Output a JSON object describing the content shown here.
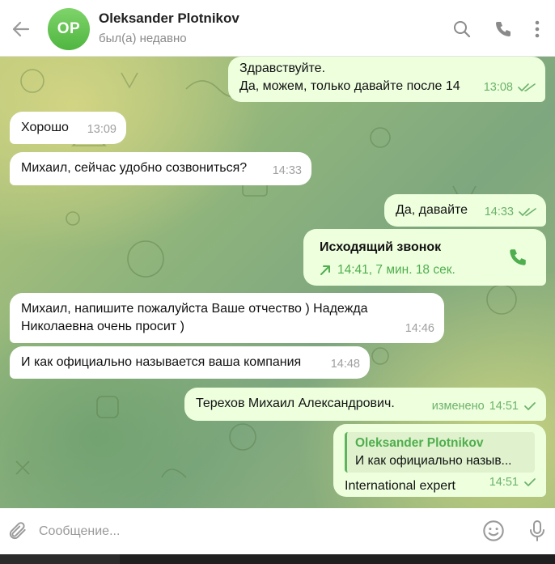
{
  "header": {
    "avatar_initials": "OP",
    "name": "Oleksander Plotnikov",
    "status": "был(а) недавно"
  },
  "messages": {
    "m1": {
      "line1": "Здравствуйте.",
      "line2": "Да, можем, только давайте после 14",
      "time": "13:08"
    },
    "m2": {
      "text": "Хорошо",
      "time": "13:09"
    },
    "m3": {
      "text": "Михаил, сейчас удобно созвониться?",
      "time": "14:33"
    },
    "m4": {
      "text": "Да, давайте",
      "time": "14:33"
    },
    "m5": {
      "title": "Исходящий звонок",
      "detail": "14:41, 7 мин. 18 сек."
    },
    "m6": {
      "line1": "Михаил, напишите пожалуйста Ваше отчество ) Надежда",
      "line2": "Николаевна очень просит )",
      "time": "14:46"
    },
    "m7": {
      "text": "И как официально называется ваша компания",
      "time": "14:48"
    },
    "m8": {
      "text": "Терехов Михаил Александрович.",
      "edited": "изменено",
      "time": "14:51"
    },
    "m9": {
      "reply_name": "Oleksander Plotnikov",
      "reply_text": "И как официально назыв...",
      "text": "International expert",
      "time": "14:51"
    }
  },
  "composer": {
    "placeholder": "Сообщение..."
  },
  "colors": {
    "accent": "#4fae4e",
    "outgoing_bubble": "#eeffde",
    "incoming_bubble": "#ffffff"
  }
}
